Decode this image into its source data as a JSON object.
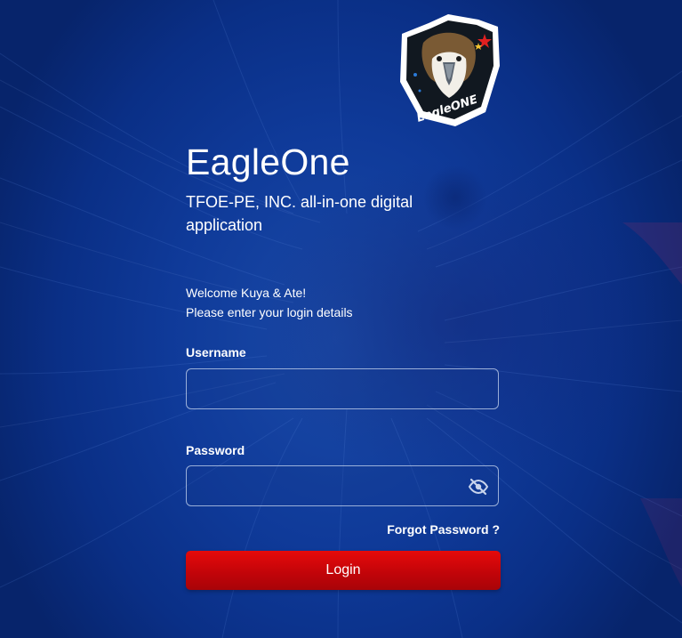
{
  "app": {
    "title": "EagleOne",
    "subtitle": "TFOE-PE, INC. all-in-one digital application",
    "logo_icon": "eagle-logo-icon",
    "logo_text": "EagleONE"
  },
  "welcome": {
    "line1": "Welcome Kuya & Ate!",
    "line2": "Please enter your login details"
  },
  "form": {
    "username_label": "Username",
    "username_value": "",
    "password_label": "Password",
    "password_value": "",
    "password_toggle_icon": "eye-slash-icon",
    "forgot_label": "Forgot Password ?",
    "login_label": "Login"
  },
  "colors": {
    "background": "#0a2f86",
    "accent_button": "#d4060b",
    "text": "#ffffff"
  }
}
